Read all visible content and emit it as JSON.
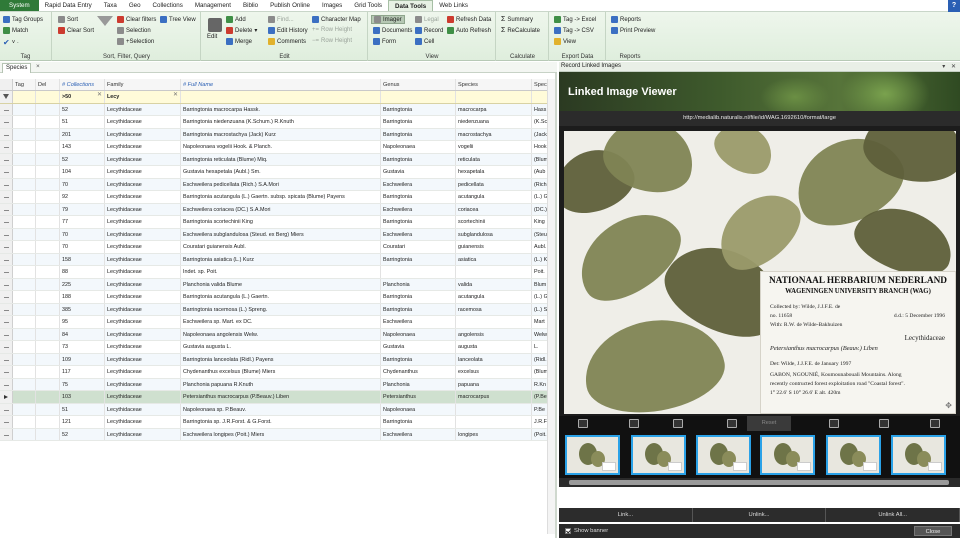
{
  "menu": {
    "tabs": [
      "System",
      "Rapid Data Entry",
      "Taxa",
      "Geo",
      "Collections",
      "Management",
      "Biblio",
      "Publish Online",
      "Images",
      "Grid Tools",
      "Data Tools",
      "Web Links"
    ],
    "help": "?"
  },
  "ribbon": {
    "tag": {
      "label": "Tag",
      "tag_groups": "Tag Groups",
      "match": "Match"
    },
    "sort": {
      "label": "Sort, Filter, Query",
      "sort": "Sort",
      "clear_sort": "Clear Sort",
      "clear_filters": "Clear filters",
      "tree_view": "Tree View",
      "selection": "Selection",
      "plus_selection": "+Selection"
    },
    "edit": {
      "label": "Edit",
      "edit": "Edit",
      "add": "Add",
      "delete": "Delete",
      "merge": "Merge",
      "find": "Find...",
      "edit_history": "Edit History",
      "comments": "Comments",
      "character_map": "Character Map",
      "row_height_plus": "Row Height",
      "row_height_minus": "Row Height"
    },
    "view": {
      "label": "View",
      "imager": "Imager",
      "documents": "Documents",
      "form": "Form",
      "legal": "Legal",
      "record": "Record",
      "cell": "Cell",
      "refresh_data": "Refresh Data",
      "auto_refresh": "Auto Refresh"
    },
    "calculate": {
      "label": "Calculate",
      "summary": "Summary",
      "recalculate": "ReCalculate"
    },
    "export": {
      "label": "Export Data",
      "tag_excel": "Tag -> Excel",
      "tag_csv": "Tag -> CSV",
      "view": "View"
    },
    "reports": {
      "label": "Reports",
      "reports": "Reports",
      "print_preview": "Print Preview"
    }
  },
  "left_tab": {
    "label": "Species",
    "close": "×"
  },
  "grid": {
    "headers": [
      "Tag",
      "Del",
      "# Collections",
      "Family",
      "# Full Name",
      "Genus",
      "Species",
      "Spec"
    ],
    "filter": {
      "collections": ">50",
      "family": "Lecy"
    },
    "rows": [
      [
        "52",
        "Lecythidaceae",
        "Barringtonia macrocarpa Hassk.",
        "Barringtonia",
        "macrocarpa",
        "Hass"
      ],
      [
        "51",
        "Lecythidaceae",
        "Barringtonia niedenzuana (K.Schum.) R.Knuth",
        "Barringtonia",
        "niedenzuana",
        "(K.Sc"
      ],
      [
        "201",
        "Lecythidaceae",
        "Barringtonia macrostachya (Jack) Kurz",
        "Barringtonia",
        "macrostachya",
        "(Jack"
      ],
      [
        "143",
        "Lecythidaceae",
        "Napoleonaea vogelii Hook. & Planch.",
        "Napoleonaea",
        "vogelii",
        "Hook"
      ],
      [
        "52",
        "Lecythidaceae",
        "Barringtonia reticulata (Blume) Miq.",
        "Barringtonia",
        "reticulata",
        "(Blum"
      ],
      [
        "104",
        "Lecythidaceae",
        "Gustavia hexapetala (Aubl.) Sm.",
        "Gustavia",
        "hexapetala",
        "(Aub"
      ],
      [
        "70",
        "Lecythidaceae",
        "Eschweilera pedicellata (Rich.) S.A.Mori",
        "Eschweilera",
        "pedicellata",
        "(Rich"
      ],
      [
        "92",
        "Lecythidaceae",
        "Barringtonia acutangula (L.) Gaertn. subsp. spicata (Blume) Payens",
        "Barringtonia",
        "acutangula",
        "(L.) G"
      ],
      [
        "79",
        "Lecythidaceae",
        "Eschweilera coriacea (DC.) S.A.Mori",
        "Eschweilera",
        "coriacea",
        "(DC.)"
      ],
      [
        "77",
        "Lecythidaceae",
        "Barringtonia scortechinii King",
        "Barringtonia",
        "scortechinii",
        "King"
      ],
      [
        "70",
        "Lecythidaceae",
        "Eschweilera subglandulosa (Steud. ex Berg) Miers",
        "Eschweilera",
        "subglandulosa",
        "(Steu"
      ],
      [
        "70",
        "Lecythidaceae",
        "Couratari guianensis Aubl.",
        "Couratari",
        "guianensis",
        "Aubl."
      ],
      [
        "158",
        "Lecythidaceae",
        "Barringtonia asiatica (L.) Kurz",
        "Barringtonia",
        "asiatica",
        "(L.) K"
      ],
      [
        "88",
        "Lecythidaceae",
        "Indet. sp. Poit.",
        "",
        "",
        "Poit."
      ],
      [
        "225",
        "Lecythidaceae",
        "Planchonia valida Blume",
        "Planchonia",
        "valida",
        "Blum"
      ],
      [
        "188",
        "Lecythidaceae",
        "Barringtonia acutangula (L.) Gaertn.",
        "Barringtonia",
        "acutangula",
        "(L.) G"
      ],
      [
        "385",
        "Lecythidaceae",
        "Barringtonia racemosa (L.) Spreng.",
        "Barringtonia",
        "racemosa",
        "(L.) S"
      ],
      [
        "95",
        "Lecythidaceae",
        "Eschweilera sp. Mart. ex DC.",
        "Eschweilera",
        "",
        "Mart"
      ],
      [
        "84",
        "Lecythidaceae",
        "Napoleonaea angolensis Welw.",
        "Napoleonaea",
        "angolensis",
        "Welw"
      ],
      [
        "73",
        "Lecythidaceae",
        "Gustavia augusta L.",
        "Gustavia",
        "augusta",
        "L."
      ],
      [
        "109",
        "Lecythidaceae",
        "Barringtonia lanceolata (Ridl.) Payens",
        "Barringtonia",
        "lanceolata",
        "(Ridl."
      ],
      [
        "117",
        "Lecythidaceae",
        "Chydenanthus excelsus (Blume) Miers",
        "Chydenanthus",
        "excelsus",
        "(Blum"
      ],
      [
        "75",
        "Lecythidaceae",
        "Planchonia papuana R.Knuth",
        "Planchonia",
        "papuana",
        "R.Kn"
      ],
      [
        "103",
        "Lecythidaceae",
        "Petersianthus macrocarpus (P.Beauv.) Liben",
        "Petersianthus",
        "macrocarpus",
        "(P.Be"
      ],
      [
        "51",
        "Lecythidaceae",
        "Napoleonaea sp. P.Beauv.",
        "Napoleonaea",
        "",
        "P.Be"
      ],
      [
        "121",
        "Lecythidaceae",
        "Barringtonia sp. J.R.Forst. & G.Forst.",
        "Barringtonia",
        "",
        "J.R.F"
      ],
      [
        "52",
        "Lecythidaceae",
        "Eschweilera longipes (Poit.) Miers",
        "Eschweilera",
        "longipes",
        "(Poit."
      ]
    ],
    "selected_row": 23
  },
  "viewer": {
    "panel_title": "Record Linked Images",
    "panel_controls": "▾ ✕",
    "banner_title": "Linked Image Viewer",
    "url": "http://medialib.naturalis.nl/file/id/WAG.1692610/format/large",
    "label": {
      "line1": "NATIONAAL HERBARIUM NEDERLAND",
      "line2": "WAGENINGEN UNIVERSITY BRANCH (WAG)",
      "collected": "Collected by: Wilde, J.J.F.E. de",
      "number": "no.  11658",
      "date": "d.d.: 5 December 1996",
      "with": "With: R.W. de Wilde-Bakhuizen",
      "family": "Lecythidaceae",
      "species": "Petersianthus macrocarpus  (Beauv.) Liben",
      "det": "Det: Wilde, J.J.F.E. de      January 1997",
      "loc1": "GABON, NGOUNIÉ, Koumounabouali Mountains. Along",
      "loc2": "recently contructed forest exploitation road \"Coastal forest\".",
      "coords": "1° 22.6' S  10° 26.6' E   alt. 420m"
    },
    "reset": "Reset",
    "link": "Link...",
    "unlink": "Unlink...",
    "unlink_all": "Unlink All...",
    "show_banner": "Show banner",
    "close": "Close"
  }
}
